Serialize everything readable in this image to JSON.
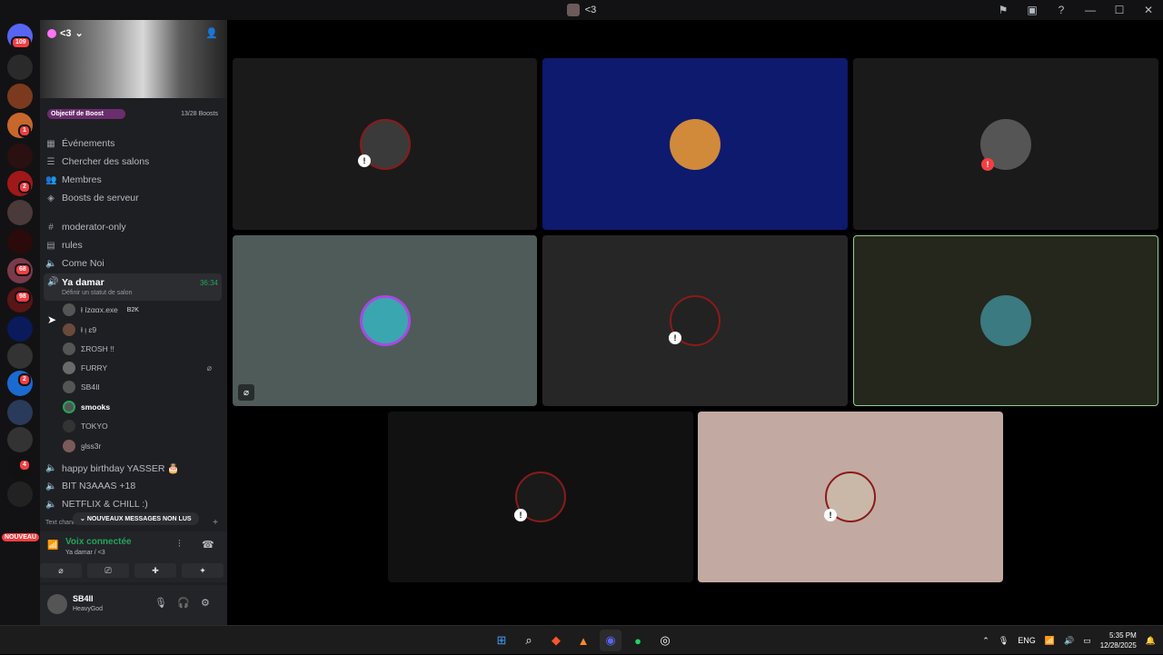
{
  "window": {
    "title": "<3"
  },
  "titlebar_icons": [
    "inbox-icon",
    "screen-icon",
    "help-icon",
    "minimize-icon",
    "maximize-icon",
    "close-icon"
  ],
  "guilds": {
    "home_badge": "109",
    "badges": [
      "1",
      "2",
      "68",
      "98",
      "2",
      "4"
    ],
    "new_label": "NOUVEAU"
  },
  "server": {
    "name": "<3",
    "boost_label": "Objectif de Boost",
    "boost_count": "13/28 Boosts"
  },
  "nav": [
    "Événements",
    "Chercher des salons",
    "Membres",
    "Boosts de serveur"
  ],
  "channels_top": [
    "moderator-only",
    "rules",
    "Come Noi"
  ],
  "active_channel": {
    "name": "Ya damar",
    "status": "Définir un statut de salon",
    "time": "36:34"
  },
  "members": [
    {
      "name": "ł ízααх.ехе",
      "tag": "B2K"
    },
    {
      "name": "ł ᴉ ɛ9",
      "tag": ""
    },
    {
      "name": "ΣROSH !!",
      "tag": ""
    },
    {
      "name": "FURRY",
      "tag": ""
    },
    {
      "name": "SB4II",
      "tag": ""
    },
    {
      "name": "smooks",
      "tag": ""
    },
    {
      "name": "TOKYO",
      "tag": ""
    },
    {
      "name": "ყlss3r",
      "tag": ""
    }
  ],
  "channels_bottom": [
    "happy birthday YASSER 🎂",
    "BIT N3AAAS +18",
    "NETFLIX & CHILL :)"
  ],
  "unread_label": "NOUVEAUX MESSAGES NON LUS",
  "text_channels_label": "Text channels",
  "voice": {
    "status": "Voix connectée",
    "location": "Ya damar / <3"
  },
  "user": {
    "name": "SB4II",
    "status": "HeavyGod"
  },
  "tiles": [
    {
      "bg": "#1a1a1a",
      "mute": true
    },
    {
      "bg": "#0d1a6e",
      "mute": false
    },
    {
      "bg": "#1a1a1a",
      "mute": true
    },
    {
      "bg": "#4f5b58",
      "mute": false,
      "corner_mute": true
    },
    {
      "bg": "#262626",
      "mute": true
    },
    {
      "bg": "#25261c",
      "mute": false,
      "speaking": true
    },
    {
      "bg": "#111111",
      "mute": true
    },
    {
      "bg": "#c2aaa2",
      "mute": true
    }
  ],
  "taskbar": {
    "lang": "ENG",
    "time": "5:35 PM",
    "date": "12/28/2025"
  }
}
